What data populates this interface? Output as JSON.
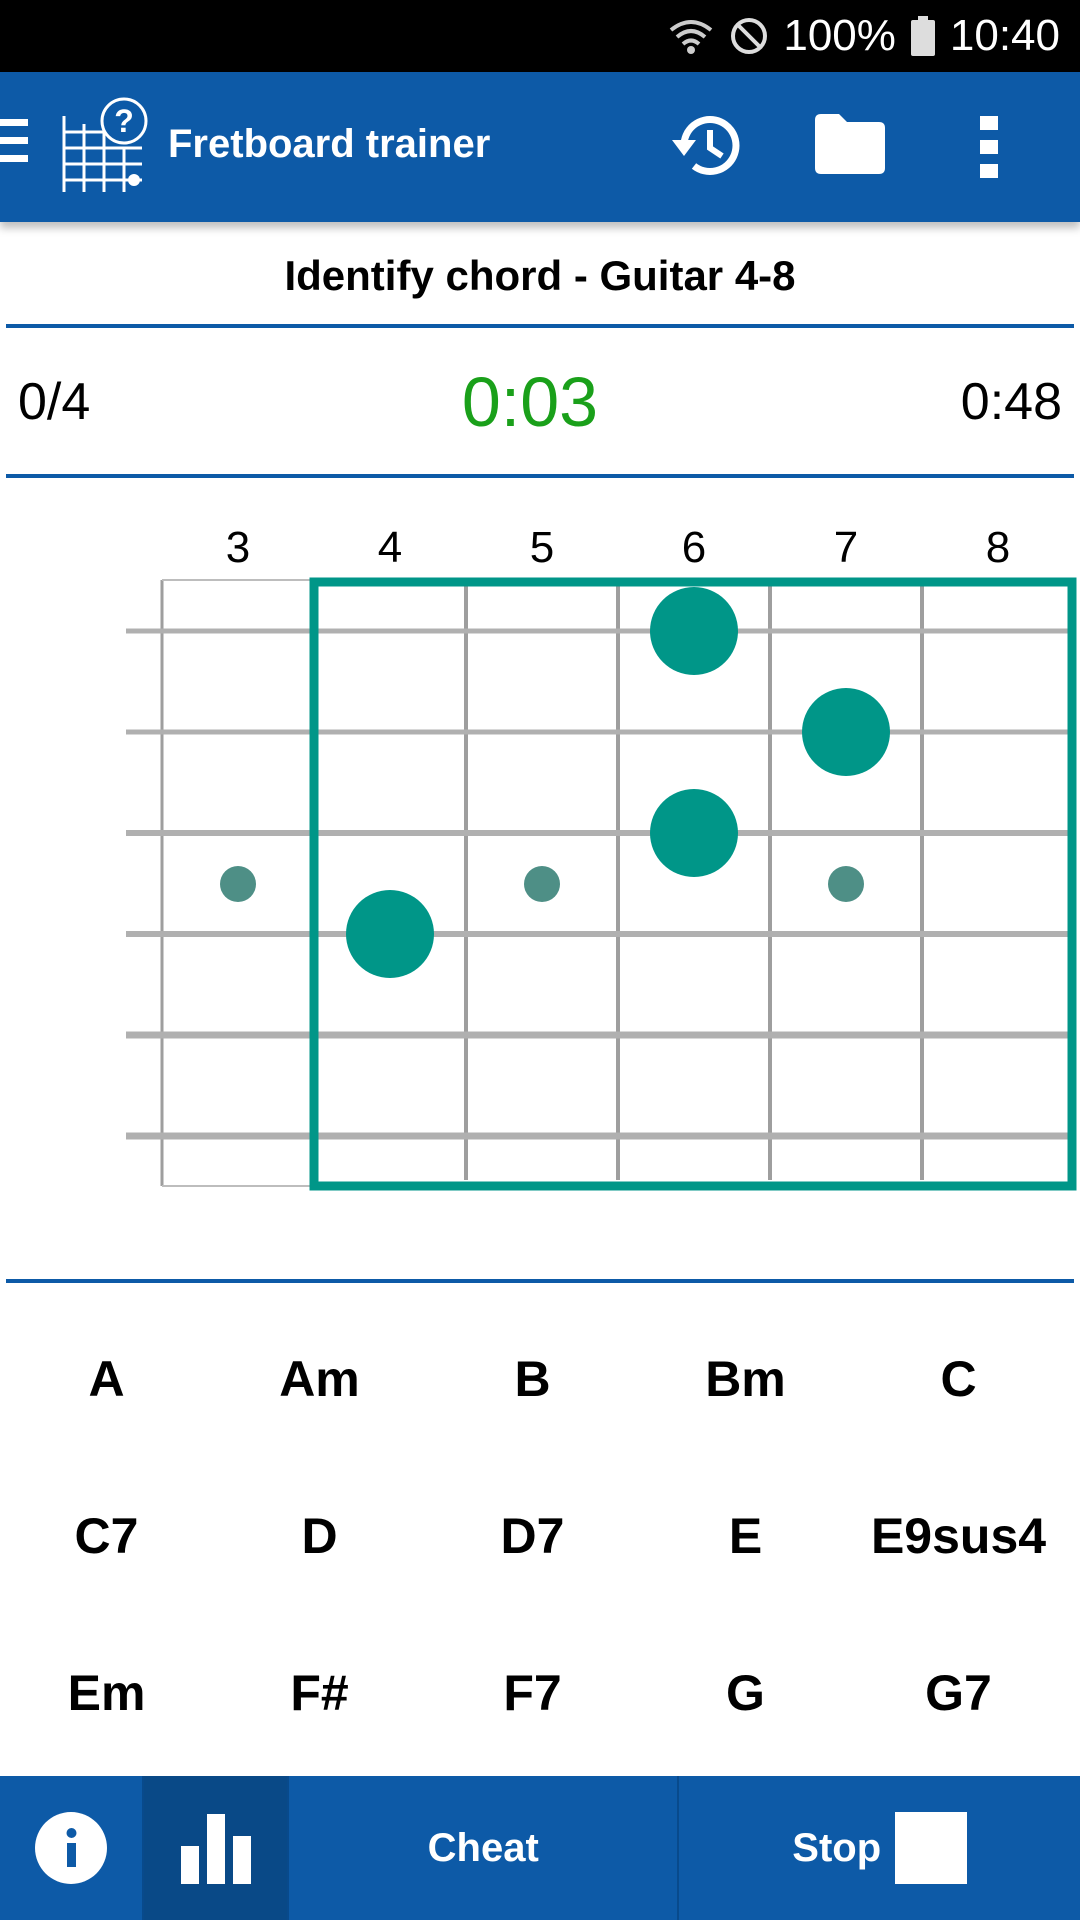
{
  "status_bar": {
    "battery": "100%",
    "time": "10:40"
  },
  "app_bar": {
    "title": "Fretboard trainer",
    "icons": [
      "menu-icon",
      "app-logo-icon",
      "history-icon",
      "folder-icon",
      "more-vert-icon"
    ]
  },
  "exercise": {
    "title": "Identify chord - Guitar 4-8"
  },
  "progress": {
    "score": "0/4",
    "timer": "0:03",
    "remaining": "0:48",
    "timer_color": "#1aa01a"
  },
  "fretboard": {
    "fret_numbers": [
      "3",
      "4",
      "5",
      "6",
      "7",
      "8"
    ],
    "strings": 6,
    "highlight_range": "4-8",
    "notes": [
      {
        "string": 1,
        "fret": 6
      },
      {
        "string": 2,
        "fret": 7
      },
      {
        "string": 3,
        "fret": 6
      },
      {
        "string": 4,
        "fret": 4
      }
    ],
    "inlay_frets": [
      3,
      5,
      7
    ],
    "accent_color": "#009688"
  },
  "chords": [
    [
      "A",
      "Am",
      "B",
      "Bm",
      "C"
    ],
    [
      "C7",
      "D",
      "D7",
      "E",
      "E9sus4"
    ],
    [
      "Em",
      "F#",
      "F7",
      "G",
      "G7"
    ]
  ],
  "bottom_bar": {
    "info_icon": "info-icon",
    "stats_icon": "bar-chart-icon",
    "cheat_label": "Cheat",
    "stop_label": "Stop"
  },
  "colors": {
    "primary": "#0d5aa7",
    "accent": "#009688"
  }
}
